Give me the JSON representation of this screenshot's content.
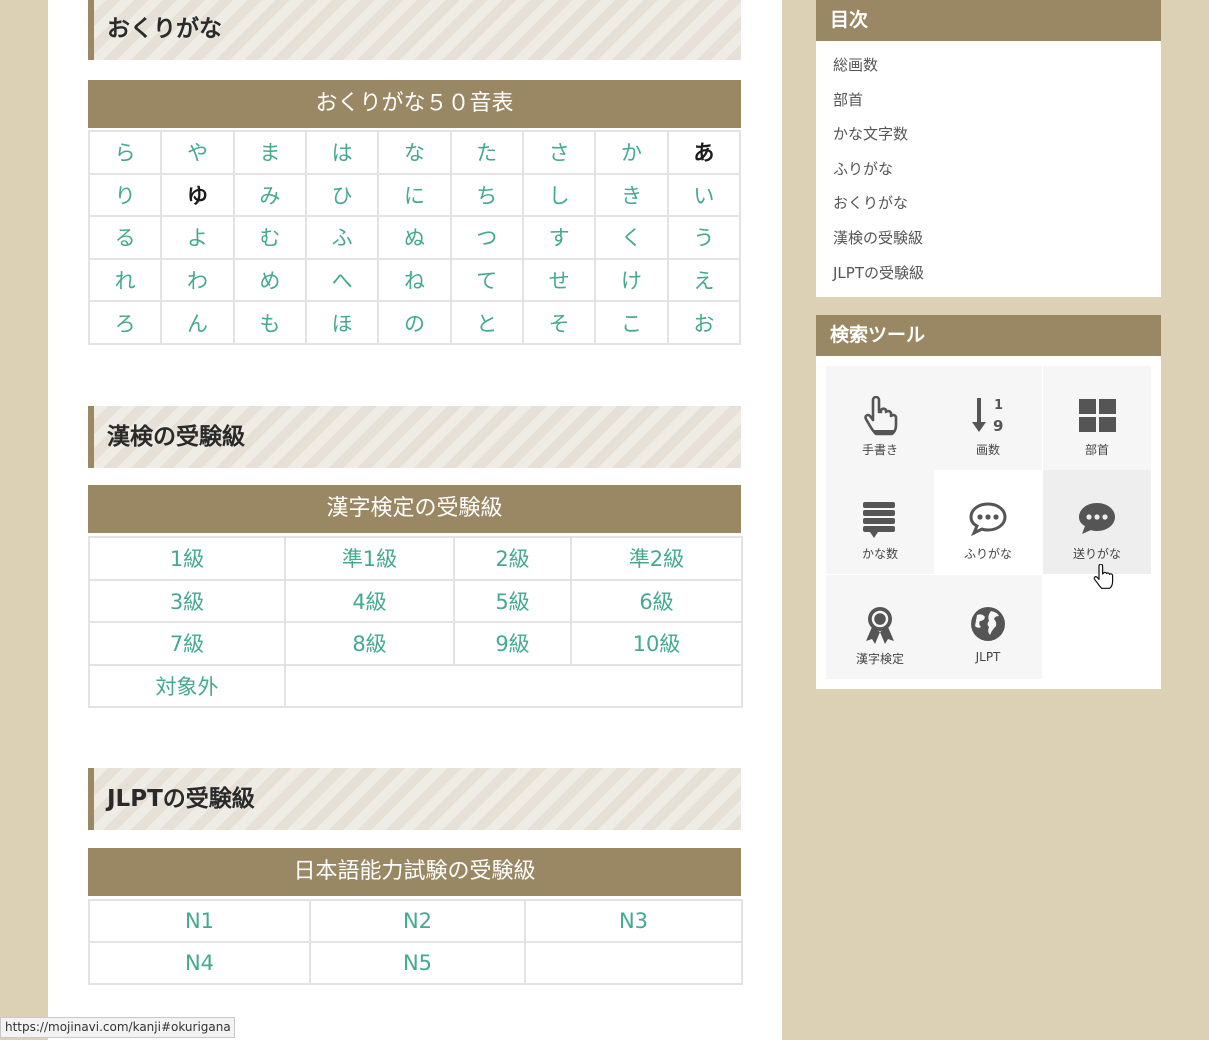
{
  "sections": {
    "okurigana": {
      "heading": "おくりがな",
      "caption": "おくりがな５０音表",
      "rows": [
        [
          "ら",
          "や",
          "ま",
          "は",
          "な",
          "た",
          "さ",
          "か",
          "あ"
        ],
        [
          "り",
          "ゆ",
          "み",
          "ひ",
          "に",
          "ち",
          "し",
          "き",
          "い"
        ],
        [
          "る",
          "よ",
          "む",
          "ふ",
          "ぬ",
          "つ",
          "す",
          "く",
          "う"
        ],
        [
          "れ",
          "わ",
          "め",
          "へ",
          "ね",
          "て",
          "せ",
          "け",
          "え"
        ],
        [
          "ろ",
          "ん",
          "も",
          "ほ",
          "の",
          "と",
          "そ",
          "こ",
          "お"
        ]
      ]
    },
    "kanken": {
      "heading": "漢検の受験級",
      "caption": "漢字検定の受験級",
      "rows": [
        [
          "1級",
          "準1級",
          "2級",
          "準2級"
        ],
        [
          "3級",
          "4級",
          "5級",
          "6級"
        ],
        [
          "7級",
          "8級",
          "9級",
          "10級"
        ],
        [
          "対象外"
        ]
      ]
    },
    "jlpt": {
      "heading": "JLPTの受験級",
      "caption": "日本語能力試験の受験級",
      "rows": [
        [
          "N1",
          "N2",
          "N3"
        ],
        [
          "N4",
          "N5",
          ""
        ]
      ]
    }
  },
  "sidebar": {
    "toc": {
      "title": "目次",
      "items": [
        "総画数",
        "部首",
        "かな文字数",
        "ふりがな",
        "おくりがな",
        "漢検の受験級",
        "JLPTの受験級"
      ]
    },
    "tools": {
      "title": "検索ツール",
      "items": [
        {
          "label": "手書き",
          "icon": "hand-pointer-icon"
        },
        {
          "label": "画数",
          "icon": "sort-numeric-icon"
        },
        {
          "label": "部首",
          "icon": "grid-icon"
        },
        {
          "label": "かな数",
          "icon": "list-stack-icon"
        },
        {
          "label": "ふりがな",
          "icon": "speech-bubble-outline-icon"
        },
        {
          "label": "送りがな",
          "icon": "speech-bubble-icon"
        },
        {
          "label": "漢字検定",
          "icon": "award-ribbon-icon"
        },
        {
          "label": "JLPT",
          "icon": "globe-icon"
        }
      ]
    }
  },
  "status_bar": {
    "url": "https://mojinavi.com/kanji#okurigana"
  },
  "colors": {
    "accent": "#998863",
    "link": "#44a98f",
    "page_background": "#dcd0b5"
  }
}
